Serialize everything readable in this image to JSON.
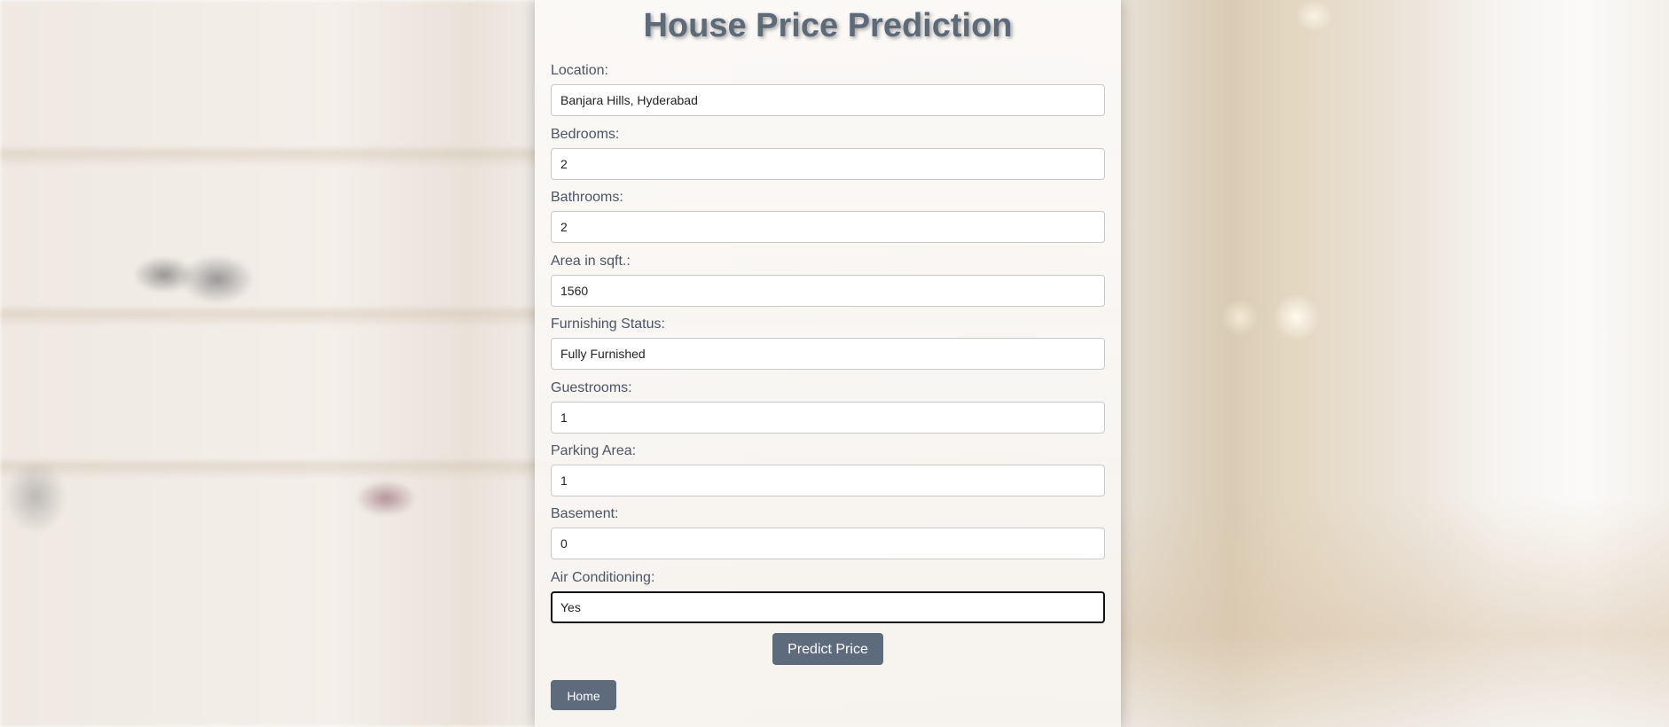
{
  "page": {
    "title": "House Price Prediction"
  },
  "form": {
    "fields": [
      {
        "label": "Location:",
        "value": "Banjara Hills, Hyderabad"
      },
      {
        "label": "Bedrooms:",
        "value": "2"
      },
      {
        "label": "Bathrooms:",
        "value": "2"
      },
      {
        "label": "Area in sqft.:",
        "value": "1560"
      },
      {
        "label": "Furnishing Status:",
        "value": "Fully Furnished"
      },
      {
        "label": "Guestrooms:",
        "value": "1"
      },
      {
        "label": "Parking Area:",
        "value": "1"
      },
      {
        "label": "Basement:",
        "value": "0"
      },
      {
        "label": "Air Conditioning:",
        "value": "Yes"
      }
    ],
    "submit_label": "Predict Price"
  },
  "nav": {
    "home_label": "Home"
  },
  "colors": {
    "button_bg": "#5d6b7c",
    "title_color": "#5d6a7a",
    "label_color": "#4a5566"
  }
}
